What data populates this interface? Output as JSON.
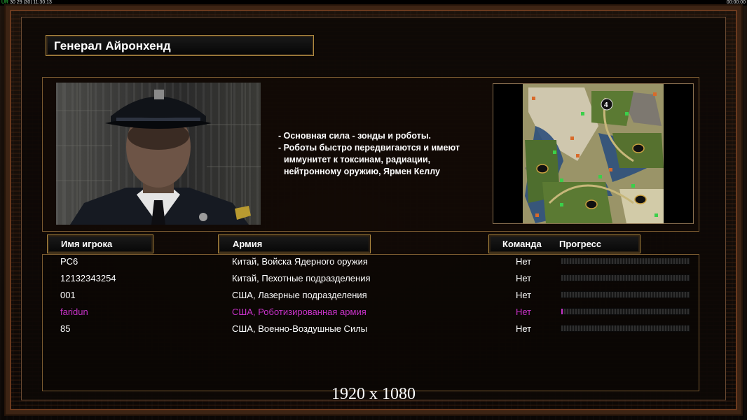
{
  "status_bar": {
    "left_prefix": "UR",
    "left_a": "30",
    "left_b": "29",
    "left_c": "[30]",
    "left_time": "11:30:13",
    "right_time": "00:00:00"
  },
  "general": {
    "title": "Генерал Айронхенд",
    "description": [
      "- Основная сила - зонды и роботы.",
      "- Роботы быстро передвигаются и имеют",
      "иммунитет к токсинам, радиации,",
      "нейтронному оружию, Ярмен Келлу"
    ]
  },
  "map": {
    "marker_label": "4"
  },
  "table": {
    "headers": {
      "player_name": "Имя игрока",
      "army": "Армия",
      "team": "Команда",
      "progress": "Прогресс"
    },
    "rows": [
      {
        "name": "PC6",
        "army": "Китай, Войска Ядерного оружия",
        "team": "Нет",
        "progress": 0,
        "color": "#ffffff"
      },
      {
        "name": "12132343254",
        "army": "Китай, Пехотные подразделения",
        "team": "Нет",
        "progress": 0,
        "color": "#ffffff"
      },
      {
        "name": "001",
        "army": "США, Лазерные подразделения",
        "team": "Нет",
        "progress": 0,
        "color": "#ffffff"
      },
      {
        "name": "faridun",
        "army": "США, Роботизированная армия",
        "team": "Нет",
        "progress": 0.01,
        "color": "#c832c8"
      },
      {
        "name": "85",
        "army": "США, Военно-Воздушные Силы",
        "team": "Нет",
        "progress": 0,
        "color": "#ffffff"
      }
    ]
  },
  "resolution_label": "1920 x 1080"
}
